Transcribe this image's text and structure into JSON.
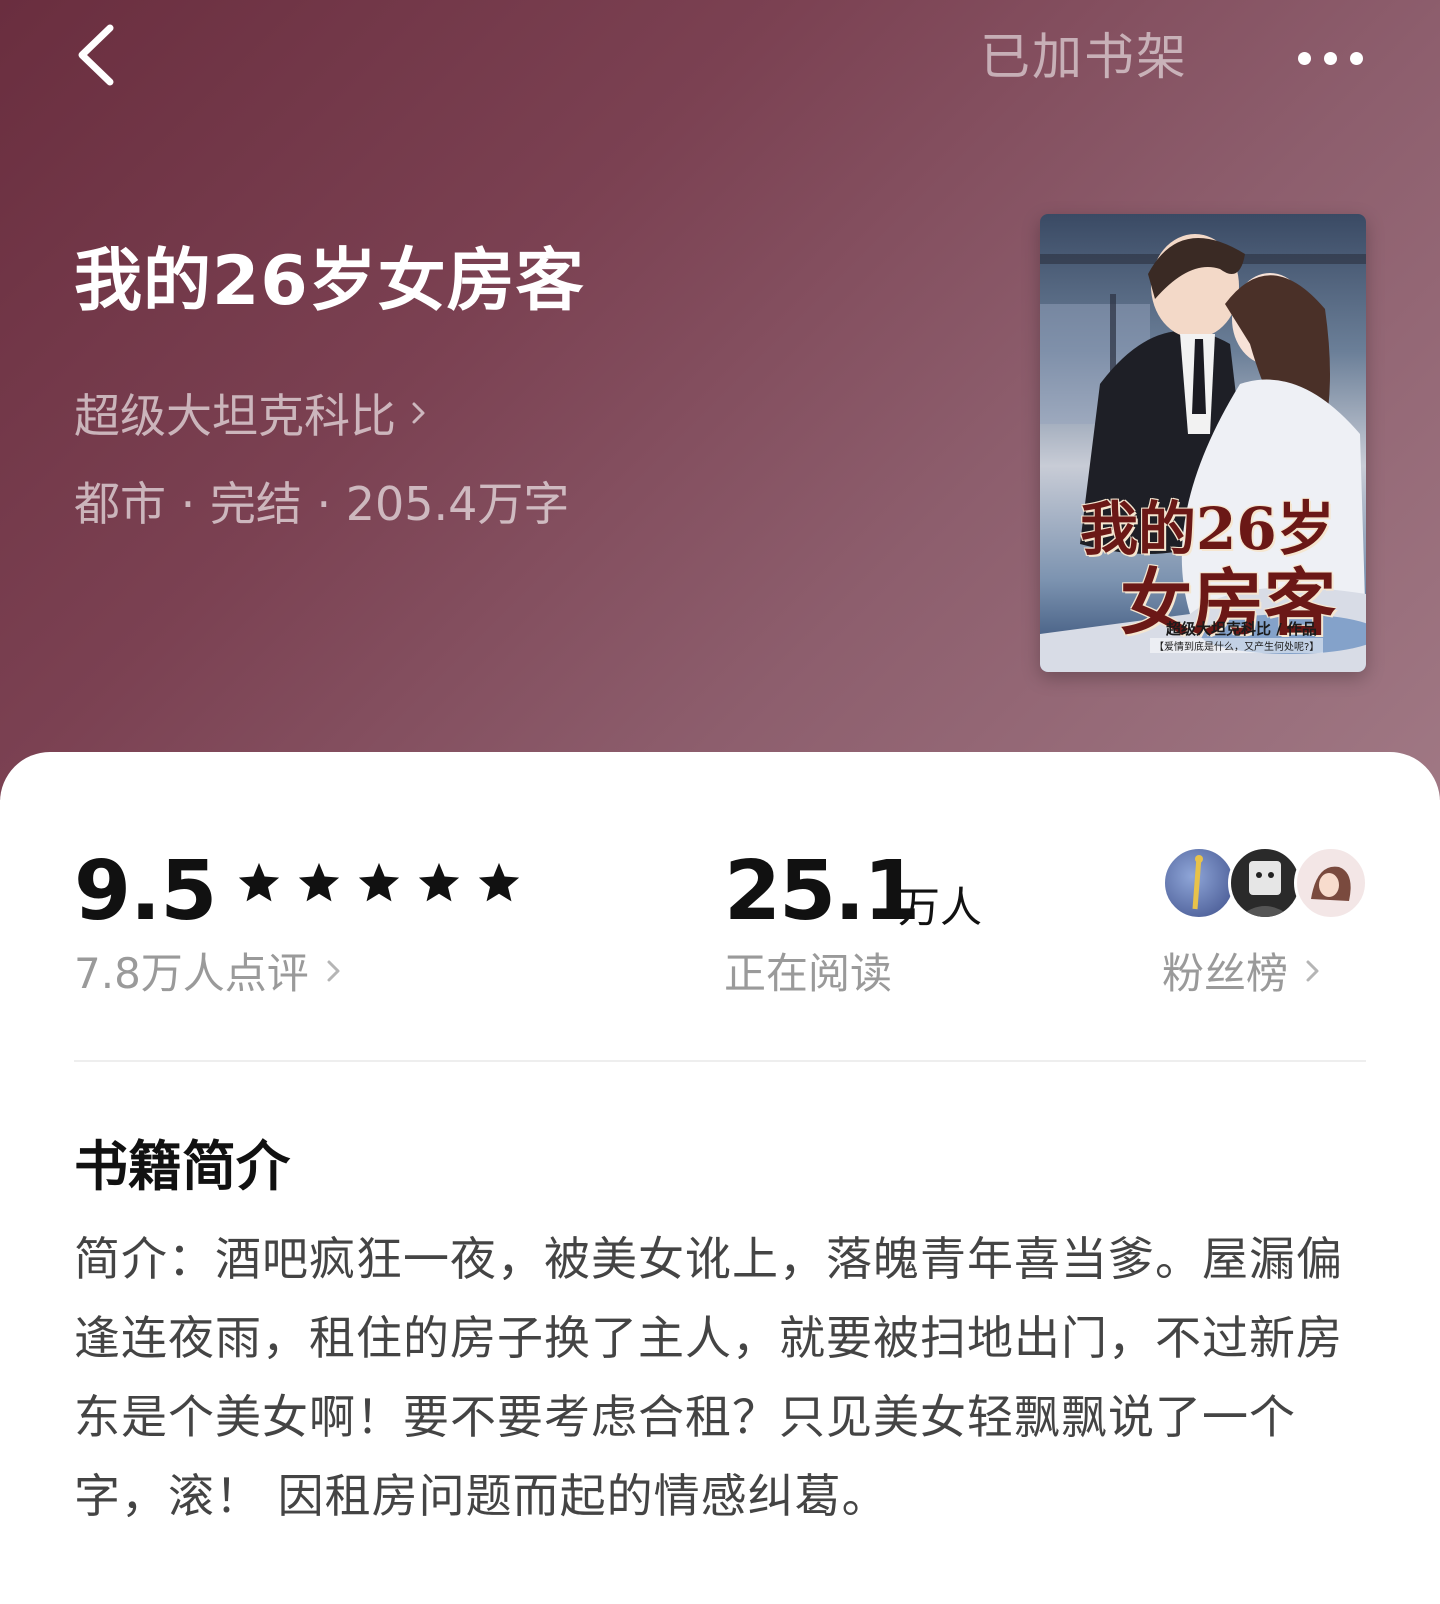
{
  "header": {
    "back_icon": "chevron-left-icon",
    "shelf_label": "已加书架",
    "more_icon": "more-horizontal-icon"
  },
  "book": {
    "title": "我的26岁女房客",
    "author": "超级大坦克科比",
    "meta": "都市 · 完结 · 205.4万字",
    "cover": {
      "title_line1": "我的26岁",
      "title_line2": "女房客",
      "author_line": "超级大坦克科比 / 作品",
      "tagline": "【爱情到底是什么，又产生何处呢?】"
    }
  },
  "stats": {
    "score": "9.5",
    "stars": 5,
    "reviews_label": "7.8万人点评",
    "readers_num": "25.1",
    "readers_unit": "万人",
    "readers_label": "正在阅读",
    "fans_label": "粉丝榜"
  },
  "intro": {
    "heading": "书籍简介",
    "text": "简介：酒吧疯狂一夜，被美女讹上，落魄青年喜当爹。屋漏偏逢连夜雨，租住的房子换了主人，就要被扫地出门，不过新房东是个美女啊！要不要考虑合租？只见美女轻飘飘说了一个字，滚！ 因租房问题而起的情感纠葛。"
  },
  "colors": {
    "hero_start": "#6a2e3f",
    "hero_end": "#a07884",
    "text_primary": "#111111",
    "text_secondary": "#9a9a9a"
  }
}
